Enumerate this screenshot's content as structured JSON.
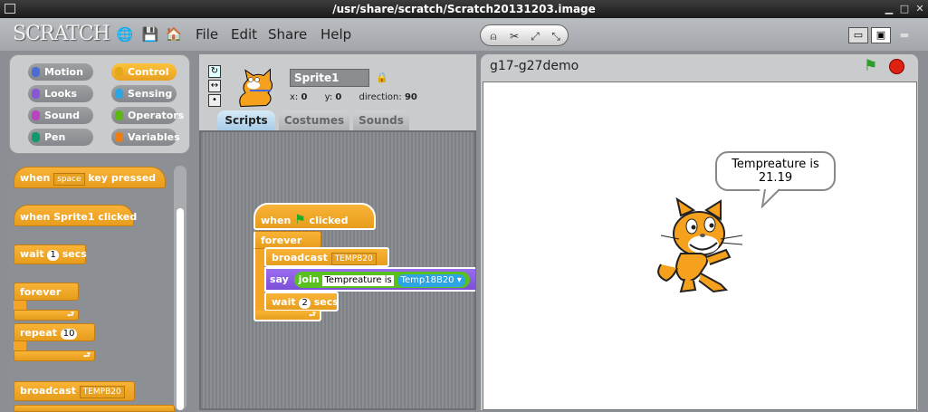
{
  "window": {
    "title": "/usr/share/scratch/Scratch20131203.image"
  },
  "app": {
    "logo": "SCRATCH"
  },
  "menu": [
    "File",
    "Edit",
    "Share",
    "Help"
  ],
  "categories": [
    {
      "label": "Motion",
      "color": "#4a6cd4"
    },
    {
      "label": "Control",
      "color": "#e1a91a",
      "selected": true
    },
    {
      "label": "Looks",
      "color": "#8a55d7"
    },
    {
      "label": "Sensing",
      "color": "#2ca5e2"
    },
    {
      "label": "Sound",
      "color": "#bb42c3"
    },
    {
      "label": "Operators",
      "color": "#5cb712"
    },
    {
      "label": "Pen",
      "color": "#0e9a6c"
    },
    {
      "label": "Variables",
      "color": "#ee7d16"
    }
  ],
  "palette": {
    "when_key": "when",
    "key": "space",
    "key_pressed": "key pressed",
    "when_clicked": "when Sprite1 clicked",
    "wait": "wait",
    "wait_val": "1",
    "secs": "secs",
    "forever": "forever",
    "repeat": "repeat",
    "repeat_val": "10",
    "broadcast": "broadcast",
    "broadcast_msg": "TEMPB20"
  },
  "sprite": {
    "name": "Sprite1",
    "x_label": "x:",
    "x": "0",
    "y_label": "y:",
    "y": "0",
    "direction_label": "direction:",
    "direction": "90"
  },
  "tabs": [
    "Scripts",
    "Costumes",
    "Sounds"
  ],
  "script": {
    "when": "when",
    "clicked": "clicked",
    "forever": "forever",
    "broadcast": "broadcast",
    "broadcast_msg": "TEMPB20",
    "say": "say",
    "join": "join",
    "join_text": "Tempreature is",
    "sensor": "Temp18B20",
    "wait": "wait",
    "wait_val": "2",
    "secs": "secs"
  },
  "stage": {
    "title": "g17-g27demo",
    "bubble_line1": "Tempreature is",
    "bubble_line2": "21.19"
  }
}
